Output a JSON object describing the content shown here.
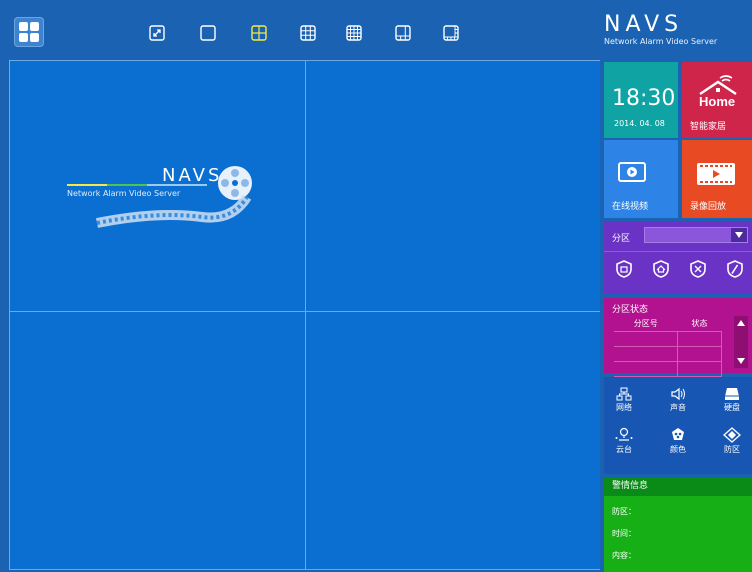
{
  "brand": {
    "title": "NAVS",
    "subtitle": "Network Alarm Video Server"
  },
  "toolbar": {
    "layouts": [
      "fullscreen-icon",
      "layout-1-icon",
      "layout-4-icon",
      "layout-9-icon",
      "layout-16-icon",
      "layout-6-icon",
      "layout-8-icon"
    ],
    "active_layout": "layout-4-icon",
    "active_color": "#f2e94b"
  },
  "watermark": {
    "title": "NAVS",
    "subtitle": "Network Alarm Video Server"
  },
  "tiles": {
    "clock": {
      "time": "18:30",
      "date": "2014. 04. 08"
    },
    "home": {
      "icon": "Home",
      "label": "智能家居"
    },
    "video": {
      "label": "在线视频"
    },
    "playback": {
      "label": "录像回放"
    }
  },
  "partition": {
    "label": "分区",
    "selected": "",
    "icons": [
      "arm-shield-icon",
      "home-arm-shield-icon",
      "disarm-x-icon",
      "clear-alarm-icon"
    ]
  },
  "partition_status": {
    "title": "分区状态",
    "columns": [
      "分区号",
      "状态"
    ],
    "rows": [
      [
        "",
        ""
      ],
      [
        "",
        ""
      ],
      [
        "",
        ""
      ]
    ]
  },
  "settings": {
    "items": [
      {
        "label": "网络",
        "icon": "network-icon"
      },
      {
        "label": "声音",
        "icon": "speaker-icon"
      },
      {
        "label": "硬盘",
        "icon": "harddisk-icon"
      },
      {
        "label": "云台",
        "icon": "ptz-icon"
      },
      {
        "label": "颜色",
        "icon": "color-icon"
      },
      {
        "label": "防区",
        "icon": "zone-icon"
      }
    ]
  },
  "alarm_info": {
    "title": "警情信息",
    "zone_label": "防区：",
    "time_label": "时间：",
    "content_label": "内容："
  },
  "colors": {
    "background": "#1b63b2",
    "video_bg": "#0a6fd0",
    "clock_tile": "#0fa3a3",
    "home_tile": "#d0254b",
    "video_tile": "#2e84e6",
    "playback_tile": "#e84a24",
    "partition_tile": "#6a33c6",
    "status_tile": "#b2128f",
    "settings_tile": "#1757b3",
    "alarm_tile": "#16b016"
  }
}
